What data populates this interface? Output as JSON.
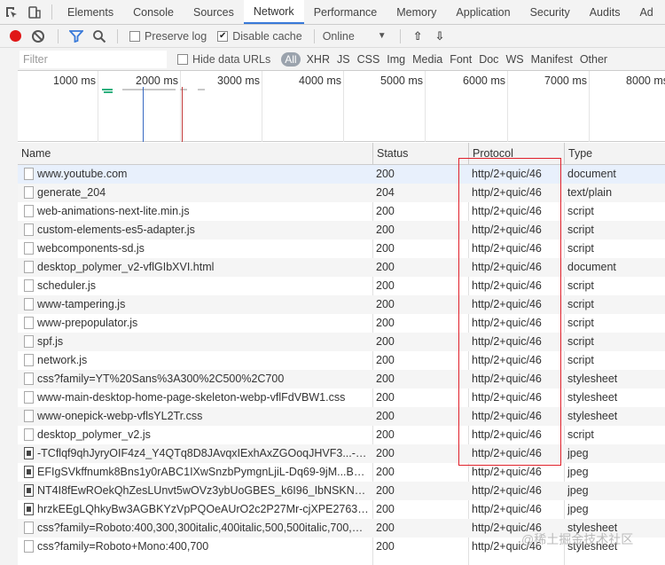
{
  "tabs": [
    "Elements",
    "Console",
    "Sources",
    "Network",
    "Performance",
    "Memory",
    "Application",
    "Security",
    "Audits",
    "Ad"
  ],
  "toolbar": {
    "preserve_log": "Preserve log",
    "disable_cache": "Disable cache",
    "throttle": "Online",
    "colors": {
      "record": "#e01717",
      "filter_active": "#3879d9"
    }
  },
  "filterbar": {
    "placeholder": "Filter",
    "hide_data_urls": "Hide data URLs",
    "types": [
      "All",
      "XHR",
      "JS",
      "CSS",
      "Img",
      "Media",
      "Font",
      "Doc",
      "WS",
      "Manifest",
      "Other"
    ]
  },
  "overview": {
    "ticks": [
      "1000 ms",
      "2000 ms",
      "3000 ms",
      "4000 ms",
      "5000 ms",
      "6000 ms",
      "7000 ms",
      "8000 ms"
    ]
  },
  "table": {
    "columns": [
      "Name",
      "Status",
      "Protocol",
      "Type"
    ],
    "rows": [
      {
        "name": "www.youtube.com",
        "status": "200",
        "protocol": "http/2+quic/46",
        "type": "document",
        "icon": "doc"
      },
      {
        "name": "generate_204",
        "status": "204",
        "protocol": "http/2+quic/46",
        "type": "text/plain",
        "icon": "doc"
      },
      {
        "name": "web-animations-next-lite.min.js",
        "status": "200",
        "protocol": "http/2+quic/46",
        "type": "script",
        "icon": "doc"
      },
      {
        "name": "custom-elements-es5-adapter.js",
        "status": "200",
        "protocol": "http/2+quic/46",
        "type": "script",
        "icon": "doc"
      },
      {
        "name": "webcomponents-sd.js",
        "status": "200",
        "protocol": "http/2+quic/46",
        "type": "script",
        "icon": "doc"
      },
      {
        "name": "desktop_polymer_v2-vflGIbXVI.html",
        "status": "200",
        "protocol": "http/2+quic/46",
        "type": "document",
        "icon": "doc"
      },
      {
        "name": "scheduler.js",
        "status": "200",
        "protocol": "http/2+quic/46",
        "type": "script",
        "icon": "doc"
      },
      {
        "name": "www-tampering.js",
        "status": "200",
        "protocol": "http/2+quic/46",
        "type": "script",
        "icon": "doc"
      },
      {
        "name": "www-prepopulator.js",
        "status": "200",
        "protocol": "http/2+quic/46",
        "type": "script",
        "icon": "doc"
      },
      {
        "name": "spf.js",
        "status": "200",
        "protocol": "http/2+quic/46",
        "type": "script",
        "icon": "doc"
      },
      {
        "name": "network.js",
        "status": "200",
        "protocol": "http/2+quic/46",
        "type": "script",
        "icon": "doc"
      },
      {
        "name": "css?family=YT%20Sans%3A300%2C500%2C700",
        "status": "200",
        "protocol": "http/2+quic/46",
        "type": "stylesheet",
        "icon": "doc"
      },
      {
        "name": "www-main-desktop-home-page-skeleton-webp-vflFdVBW1.css",
        "status": "200",
        "protocol": "http/2+quic/46",
        "type": "stylesheet",
        "icon": "doc"
      },
      {
        "name": "www-onepick-webp-vflsYL2Tr.css",
        "status": "200",
        "protocol": "http/2+quic/46",
        "type": "stylesheet",
        "icon": "doc"
      },
      {
        "name": "desktop_polymer_v2.js",
        "status": "200",
        "protocol": "http/2+quic/46",
        "type": "script",
        "icon": "doc"
      },
      {
        "name": "-TCflqf9qhJyryOIF4z4_Y4QTq8D8JAvqxIExhAxZGOoqJHVF3...-BI0eJ8f...",
        "status": "200",
        "protocol": "http/2+quic/46",
        "type": "jpeg",
        "icon": "img"
      },
      {
        "name": "EFIgSVkffnumk8Bns1y0rABC1IXwSnzbPymgnLjiL-Dq69-9jM...Bvsk_p...",
        "status": "200",
        "protocol": "http/2+quic/46",
        "type": "jpeg",
        "icon": "img"
      },
      {
        "name": "NT4I8fEwROekQhZesLUnvt5wOVz3ybUoGBES_k6I96_IbNSKN5...b6kY...",
        "status": "200",
        "protocol": "http/2+quic/46",
        "type": "jpeg",
        "icon": "img"
      },
      {
        "name": "hrzkEEgLQhkyBw3AGBKYzVpPQOeAUrO2c2P27Mr-cjXPE2763L...sE0...",
        "status": "200",
        "protocol": "http/2+quic/46",
        "type": "jpeg",
        "icon": "img"
      },
      {
        "name": "css?family=Roboto:400,300,300italic,400italic,500,500italic,700,700ita...",
        "status": "200",
        "protocol": "http/2+quic/46",
        "type": "stylesheet",
        "icon": "doc"
      },
      {
        "name": "css?family=Roboto+Mono:400,700",
        "status": "200",
        "protocol": "http/2+quic/46",
        "type": "stylesheet",
        "icon": "doc"
      }
    ]
  },
  "watermark": "@稀土掘金技术社区"
}
